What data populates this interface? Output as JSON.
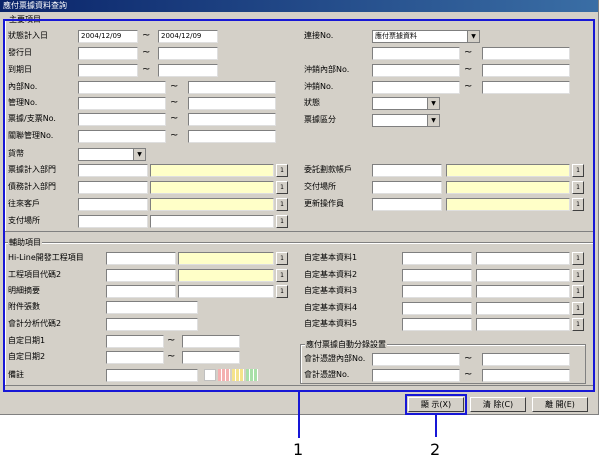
{
  "window": {
    "title": "應付票據資料查詢"
  },
  "main_group": {
    "title": "主要項目",
    "tilde": "~",
    "date_in": {
      "label": "狀態計入日",
      "from": "2004/12/09",
      "to": "2004/12/09"
    },
    "issue_date": {
      "label": "發行日"
    },
    "due_date": {
      "label": "到期日"
    },
    "internal_no": {
      "label": "內部No."
    },
    "manage_no": {
      "label": "管理No."
    },
    "bill_no": {
      "label": "票據/支票No."
    },
    "related_manage_no": {
      "label": "關聯管理No."
    },
    "currency": {
      "label": "貨幣",
      "value": ""
    },
    "bill_dept": {
      "label": "票據計入部門"
    },
    "debt_dept": {
      "label": "債務計入部門"
    },
    "partner": {
      "label": "往來客戶"
    },
    "pay_place": {
      "label": "支付場所"
    },
    "link_no": {
      "label": "連接No.",
      "value": "應付票據資料"
    },
    "offset_internal_no": {
      "label": "沖銷內部No."
    },
    "offset_no": {
      "label": "沖銷No."
    },
    "status": {
      "label": "狀態",
      "value": ""
    },
    "bill_class": {
      "label": "票據區分",
      "value": ""
    },
    "entrust_account": {
      "label": "委託劃款帳戶"
    },
    "delivery_place": {
      "label": "交付場所"
    },
    "updater": {
      "label": "更新操作員"
    },
    "lookup_icon": "1"
  },
  "aux_group": {
    "title": "輔助項目",
    "project": {
      "label": "Hi-Line開發工程項目"
    },
    "project_code2": {
      "label": "工程項目代碼2"
    },
    "detail": {
      "label": "明細摘要"
    },
    "attach_count": {
      "label": "附件張數"
    },
    "analysis_code2": {
      "label": "會計分析代碼2"
    },
    "custom_date1": {
      "label": "自定日期1"
    },
    "custom_date2": {
      "label": "自定日期2"
    },
    "note": {
      "label": "備註"
    },
    "custom1": {
      "label": "自定基本資料1"
    },
    "custom2": {
      "label": "自定基本資料2"
    },
    "custom3": {
      "label": "自定基本資料3"
    },
    "custom4": {
      "label": "自定基本資料4"
    },
    "custom5": {
      "label": "自定基本資料5"
    }
  },
  "auto_group": {
    "title": "應付票據自動分錄設置",
    "voucher_internal_no": {
      "label": "會計憑證內部No."
    },
    "voucher_no": {
      "label": "會計憑證No."
    }
  },
  "buttons": {
    "display": "顯 示(X)",
    "clear": "清 除(C)",
    "close": "離 開(E)"
  },
  "callouts": {
    "one": "1",
    "two": "2"
  },
  "colors": {
    "accent": "#1717d6",
    "highlight": "#ffffc8",
    "title_bar": "#0a246a"
  }
}
